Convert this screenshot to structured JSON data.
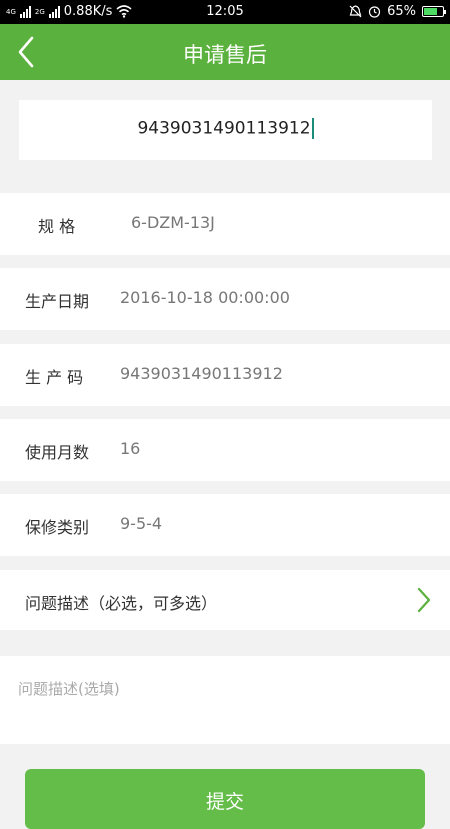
{
  "status_bar": {
    "net_badges": [
      "4G",
      "2G"
    ],
    "speed": "0.88K/s",
    "time": "12:05",
    "battery": "65%"
  },
  "navbar": {
    "title": "申请售后"
  },
  "serial_input": {
    "value": "9439031490113912"
  },
  "fields": [
    {
      "label": "规 格",
      "value": "6-DZM-13J"
    },
    {
      "label": "生产日期",
      "value": "2016-10-18 00:00:00"
    },
    {
      "label": "生 产 码",
      "value": "9439031490113912"
    },
    {
      "label": "使用月数",
      "value": "16"
    },
    {
      "label": "保修类别",
      "value": "9-5-4"
    }
  ],
  "problem_select": {
    "label": "问题描述（必选，可多选）"
  },
  "problem_text": {
    "placeholder": "问题描述(选填)"
  },
  "submit": {
    "label": "提交"
  },
  "colors": {
    "accent": "#5bb13d",
    "button": "#63bd48",
    "caret": "#1a8c7a"
  }
}
